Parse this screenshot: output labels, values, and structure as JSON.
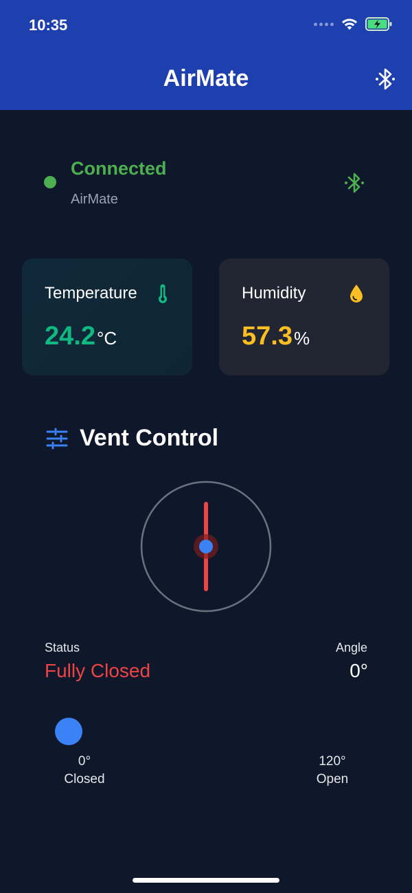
{
  "status_bar": {
    "time": "10:35"
  },
  "header": {
    "title": "AirMate",
    "bluetooth_icon": "bluetooth-icon"
  },
  "connection": {
    "status": "Connected",
    "device": "AirMate",
    "color": "#4caf50"
  },
  "sensors": {
    "temperature": {
      "label": "Temperature",
      "value": "24.2",
      "unit": "°C",
      "color": "#10b981",
      "icon": "thermometer-icon"
    },
    "humidity": {
      "label": "Humidity",
      "value": "57.3",
      "unit": "%",
      "color": "#fbbf24",
      "icon": "water-drop-icon"
    }
  },
  "vent": {
    "title": "Vent Control",
    "icon": "sliders-icon",
    "status_label": "Status",
    "status_value": "Fully Closed",
    "status_color": "#ef4444",
    "angle_label": "Angle",
    "angle_value": "0°",
    "angle_deg": 0,
    "slider": {
      "min": 0,
      "max": 120,
      "value": 0,
      "min_value": "0°",
      "min_label": "Closed",
      "max_value": "120°",
      "max_label": "Open"
    }
  },
  "colors": {
    "header": "#1e40af",
    "background": "#0f172a",
    "accent": "#3b82f6"
  }
}
